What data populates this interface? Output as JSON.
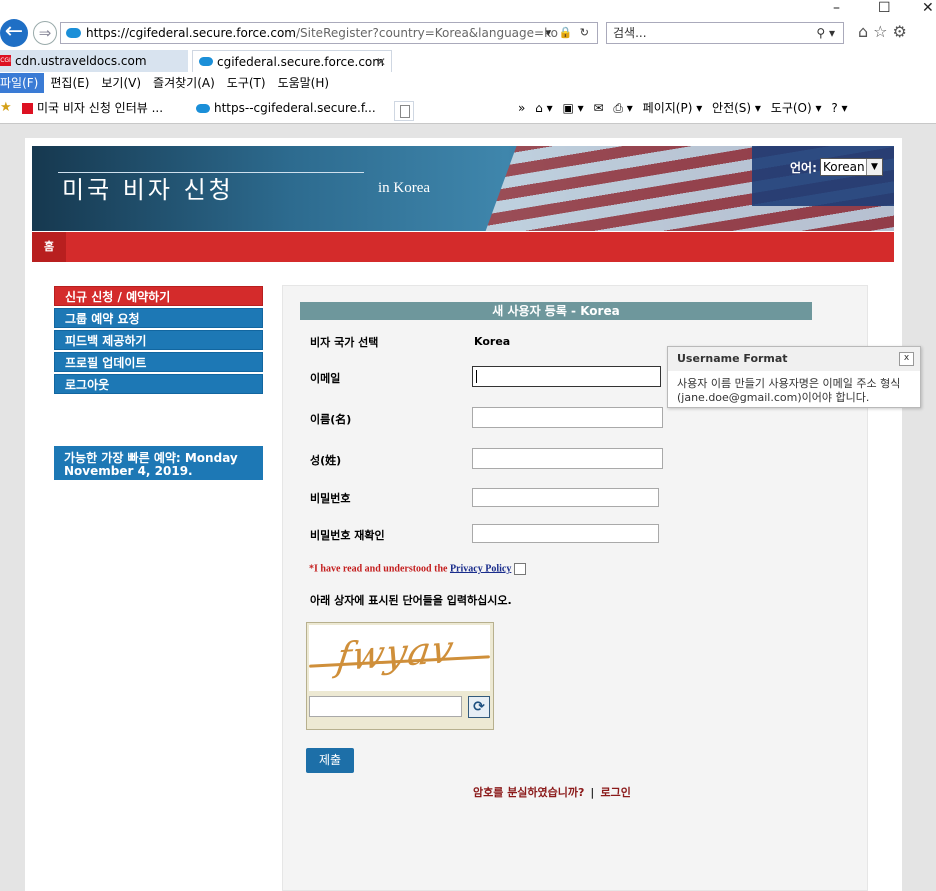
{
  "browser": {
    "url_prefix": "https://cgifederal.secure.force.com",
    "url_rest": "/SiteRegister?country=Korea&language=ko",
    "url_controls": "▾ 🔒 ↻",
    "search_placeholder": "검색...",
    "search_icon": "⚲ ▾",
    "tabs": [
      {
        "label": "cdn.ustraveldocs.com",
        "favicon": "cgi-favicon"
      },
      {
        "label": "cgifederal.secure.force.com",
        "favicon": "salesforce-favicon",
        "close": "✕"
      }
    ],
    "menu": [
      "파일(F)",
      "편집(E)",
      "보기(V)",
      "즐겨찾기(A)",
      "도구(T)",
      "도움말(H)"
    ],
    "favorites": [
      {
        "label": "미국 비자 신청 인터뷰 ..."
      },
      {
        "label": "https--cgifederal.secure.f..."
      }
    ],
    "command_bar": [
      "»",
      "⌂ ▾",
      "▣ ▾",
      "✉",
      "⎙ ▾",
      "페이지(P) ▾",
      "안전(S) ▾",
      "도구(O) ▾",
      "? ▾"
    ],
    "window_controls": [
      "–",
      "☐",
      "✕"
    ]
  },
  "banner": {
    "title": "미국 비자 신청",
    "subtitle": "in Korea",
    "language_label": "언어:",
    "language_value": "Korean",
    "language_arrow": "▼"
  },
  "redbar": {
    "home": "홈"
  },
  "sidebar": {
    "items": [
      {
        "label": "신규 신청 / 예약하기",
        "active": true
      },
      {
        "label": "그룹 예약 요청",
        "active": false
      },
      {
        "label": "피드백 제공하기",
        "active": false
      },
      {
        "label": "프로필 업데이트",
        "active": false
      },
      {
        "label": "로그아웃",
        "active": false
      }
    ],
    "earliest": "가능한 가장 빠른 예약: Monday November 4, 2019."
  },
  "form": {
    "header": "새 사용자 등록 - Korea",
    "country_label": "비자 국가 선택",
    "country_value": "Korea",
    "email_label": "이메일",
    "first_name_label": "이름(名)",
    "last_name_label": "성(姓)",
    "password_label": "비밀번호",
    "password_confirm_label": "비밀번호 재확인",
    "privacy_text": "*I have read and understood the",
    "privacy_link": "Privacy Policy",
    "captcha_instruction": "아래 상자에 표시된 단어들을 입력하십시오.",
    "captcha_word": "fwyav",
    "refresh_icon": "⟳",
    "submit": "제출",
    "forgot_password": "암호를 분실하였습니까?",
    "separator": "|",
    "login": "로그인"
  },
  "tooltip": {
    "title": "Username Format",
    "close": "x",
    "body": "사용자 이름 만들기 사용자명은 이메일 주소 형식(jane.doe@gmail.com)이어야 합니다."
  },
  "colors": {
    "accent_red": "#d42b2b",
    "nav_blue": "#1d78b5",
    "form_header": "#6e979c"
  }
}
